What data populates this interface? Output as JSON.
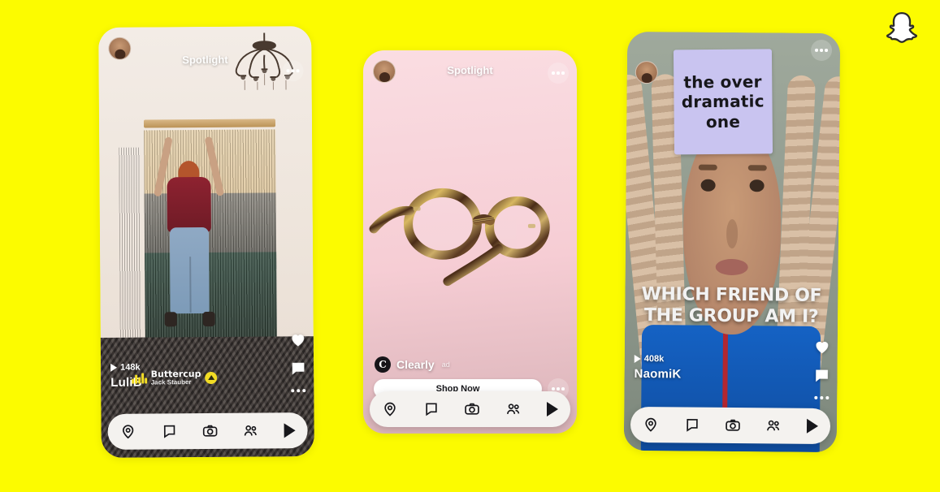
{
  "brand": {
    "logo_icon": "snapchat-ghost-icon"
  },
  "background_color": "#FCFB00",
  "phones": [
    {
      "id": "phone-1",
      "header": {
        "title": "Spotlight",
        "avatar_icon": "user-avatar",
        "menu_icon": "more-options-icon"
      },
      "views": "148k",
      "username": "LuliB",
      "music": {
        "title": "Buttercup",
        "subtitle": "Jack Stauber",
        "icon": "music-equalizer-icon",
        "badge_icon": "music-badge-icon"
      },
      "rail": {
        "like_icon": "heart-icon",
        "comment_icon": "comment-icon",
        "more_icon": "more-dots-icon"
      },
      "nav": [
        {
          "icon": "map-pin-icon",
          "name": "nav-map"
        },
        {
          "icon": "chat-bubble-icon",
          "name": "nav-chat"
        },
        {
          "icon": "camera-icon",
          "name": "nav-camera"
        },
        {
          "icon": "friends-icon",
          "name": "nav-friends"
        },
        {
          "icon": "play-icon",
          "name": "nav-spotlight"
        }
      ]
    },
    {
      "id": "phone-2",
      "header": {
        "title": "Spotlight",
        "avatar_icon": "user-avatar",
        "menu_icon": "more-options-icon"
      },
      "ad": {
        "brand_name": "Clearly",
        "brand_initial": "C",
        "label": "ad",
        "cta": "Shop Now",
        "more_icon": "more-dots-icon"
      },
      "nav": [
        {
          "icon": "map-pin-icon",
          "name": "nav-map"
        },
        {
          "icon": "chat-bubble-icon",
          "name": "nav-chat"
        },
        {
          "icon": "camera-icon",
          "name": "nav-camera"
        },
        {
          "icon": "friends-icon",
          "name": "nav-friends"
        },
        {
          "icon": "play-icon",
          "name": "nav-spotlight"
        }
      ]
    },
    {
      "id": "phone-3",
      "header": {
        "title": "Spotlight",
        "avatar_icon": "user-avatar",
        "menu_icon": "more-options-icon"
      },
      "sticky_note": {
        "line1": "the over",
        "line2": "dramatic",
        "line3": "one",
        "color": "#c9c4f0"
      },
      "caption_line1": "WHICH FRIEND OF",
      "caption_line2": "THE GROUP AM I?",
      "views": "408k",
      "username": "NaomiK",
      "rail": {
        "like_icon": "heart-icon",
        "comment_icon": "comment-icon",
        "more_icon": "more-dots-icon"
      },
      "nav": [
        {
          "icon": "map-pin-icon",
          "name": "nav-map"
        },
        {
          "icon": "chat-bubble-icon",
          "name": "nav-chat"
        },
        {
          "icon": "camera-icon",
          "name": "nav-camera"
        },
        {
          "icon": "friends-icon",
          "name": "nav-friends"
        },
        {
          "icon": "play-icon",
          "name": "nav-spotlight"
        }
      ]
    }
  ]
}
